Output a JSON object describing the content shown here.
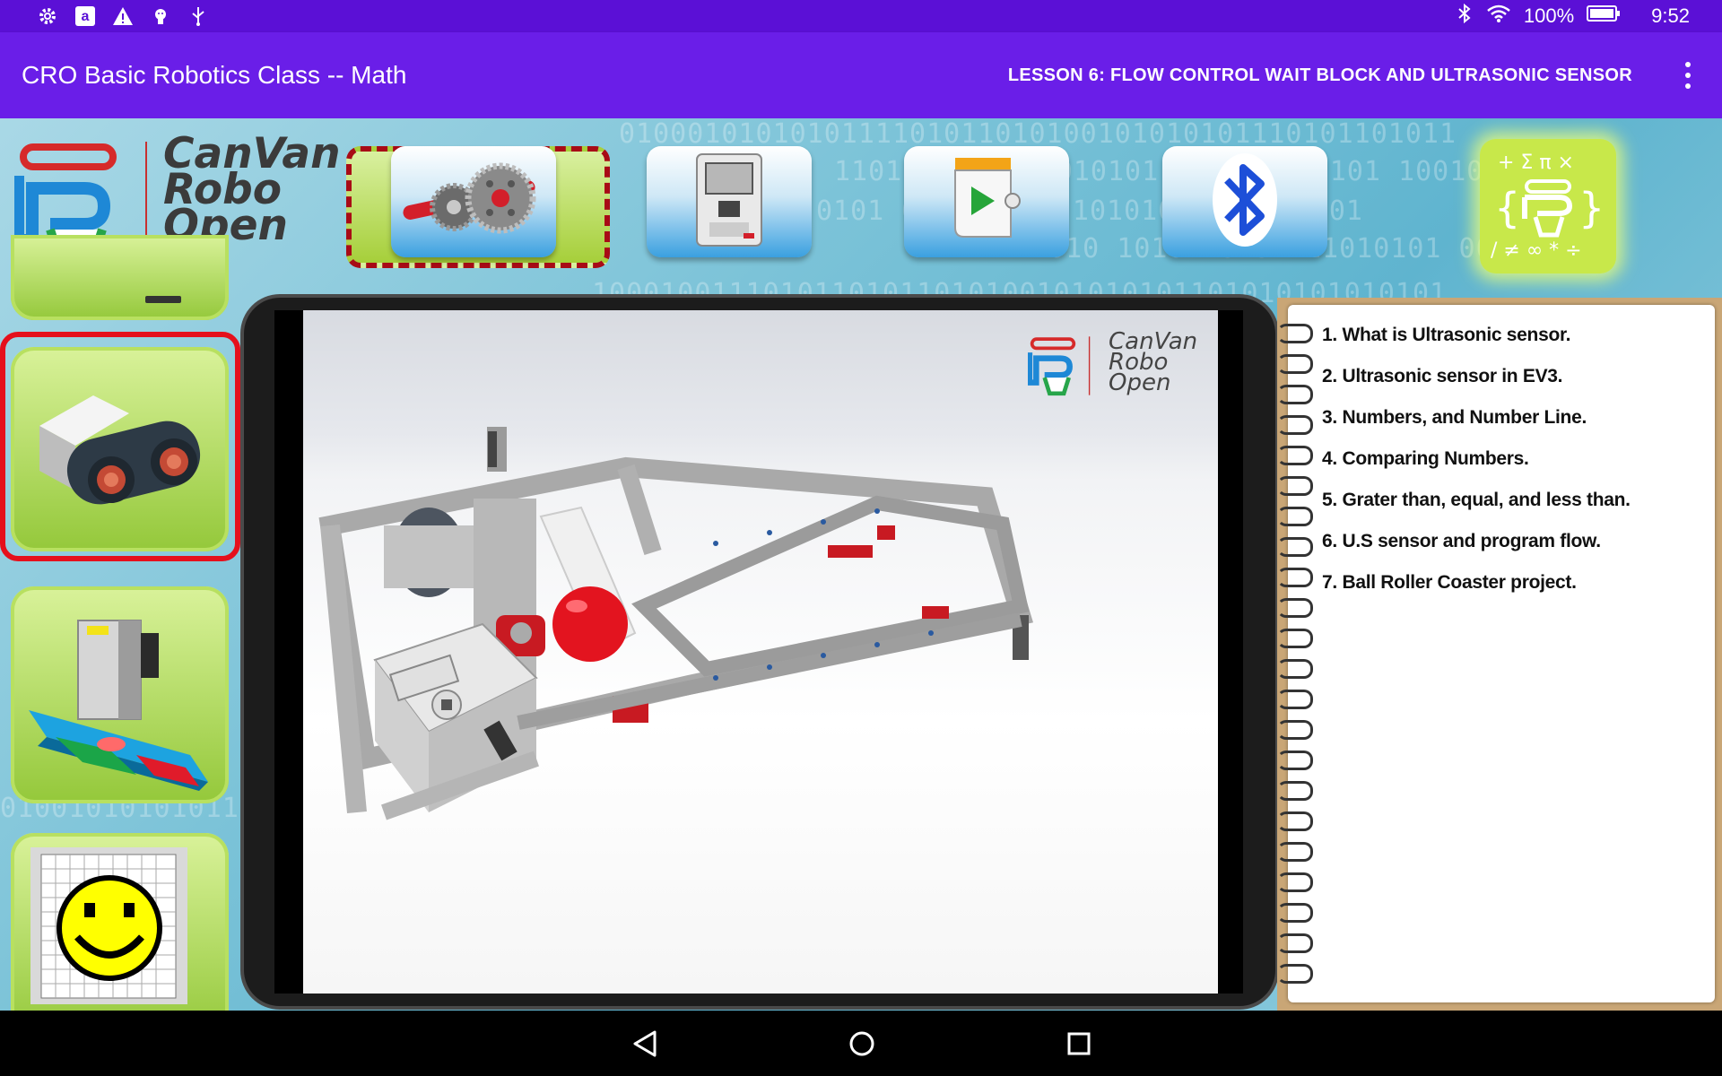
{
  "status_bar": {
    "left_icons": [
      "gear-icon",
      "amazon-icon",
      "warning-icon",
      "android-debug-icon",
      "usb-icon"
    ],
    "battery_text": "100%",
    "time": "9:52"
  },
  "app_bar": {
    "title": "CRO Basic Robotics Class -- Math",
    "lesson": "LESSON 6: FLOW CONTROL WAIT BLOCK AND ULTRASONIC SENSOR"
  },
  "logo": {
    "line1": "CanVan",
    "line2": "Robo",
    "line3": "Open"
  },
  "toolbar": {
    "buttons": [
      "gears-icon",
      "ev3-brick-icon",
      "program-block-icon",
      "bluetooth-icon",
      "math-icon"
    ]
  },
  "sidebar": {
    "items": [
      "touch-sensor-icon",
      "ultrasonic-sensor-icon",
      "color-sensor-icon",
      "smiley-display-icon"
    ]
  },
  "video": {
    "logo_line1": "CanVan",
    "logo_line2": "Robo",
    "logo_line3": "Open"
  },
  "notebook": {
    "topics": [
      "1. What is Ultrasonic sensor.",
      "2. Ultrasonic sensor in EV3.",
      "3. Numbers, and Number Line.",
      "4. Comparing Numbers.",
      "5. Grater than, equal, and less than.",
      "6. U.S sensor and program flow.",
      "7. Ball Roller Coaster project."
    ]
  },
  "colors": {
    "status_bar": "#5b10d6",
    "app_bar": "#6a1ee8",
    "selection": "#e5101c"
  }
}
